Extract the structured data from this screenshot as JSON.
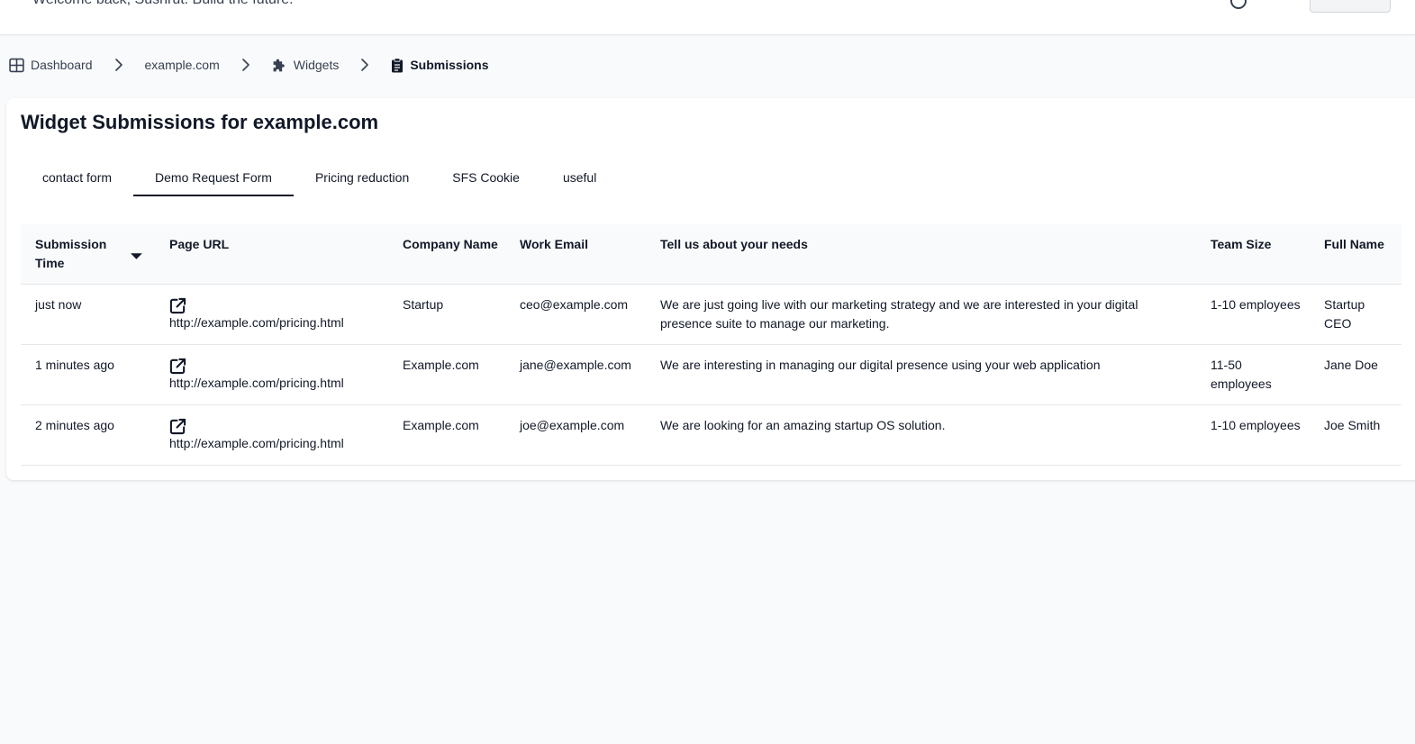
{
  "topbar": {
    "welcome": "Welcome back, Sushrut. Build the future."
  },
  "breadcrumb": {
    "items": [
      {
        "label": "Dashboard"
      },
      {
        "label": "example.com"
      },
      {
        "label": "Widgets"
      },
      {
        "label": "Submissions"
      }
    ]
  },
  "page": {
    "title": "Widget Submissions for example.com"
  },
  "tabs": [
    {
      "label": "contact form"
    },
    {
      "label": "Demo Request Form",
      "active": true
    },
    {
      "label": "Pricing reduction"
    },
    {
      "label": "SFS Cookie"
    },
    {
      "label": "useful"
    }
  ],
  "table": {
    "columns": [
      "Submission Time",
      "Page URL",
      "Company Name",
      "Work Email",
      "Tell us about your needs",
      "Team Size",
      "Full Name"
    ],
    "sort": {
      "column": "Submission Time",
      "direction": "descending"
    },
    "rows": [
      {
        "time": "just now",
        "url": "http://example.com/pricing.html",
        "company": "Startup",
        "email": "ceo@example.com",
        "needs": "We are just going live with our marketing strategy and we are interested in your digital presence suite to manage our marketing.",
        "team_size": "1-10 employees",
        "full_name": "Startup CEO"
      },
      {
        "time": "1 minutes ago",
        "url": "http://example.com/pricing.html",
        "company": "Example.com",
        "email": "jane@example.com",
        "needs": "We are interesting in managing our digital presence using your web application",
        "team_size": "11-50 employees",
        "full_name": "Jane Doe"
      },
      {
        "time": "2 minutes ago",
        "url": "http://example.com/pricing.html",
        "company": "Example.com",
        "email": "joe@example.com",
        "needs": "We are looking for an amazing startup OS solution.",
        "team_size": "1-10 employees",
        "full_name": "Joe Smith"
      }
    ]
  },
  "icons": {
    "dashboard": "grid-icon",
    "widgets": "puzzle-icon",
    "submissions": "clipboard-icon",
    "separator": "chevron-right-icon",
    "external_link": "external-link-icon",
    "sort": "caret-down-icon"
  }
}
